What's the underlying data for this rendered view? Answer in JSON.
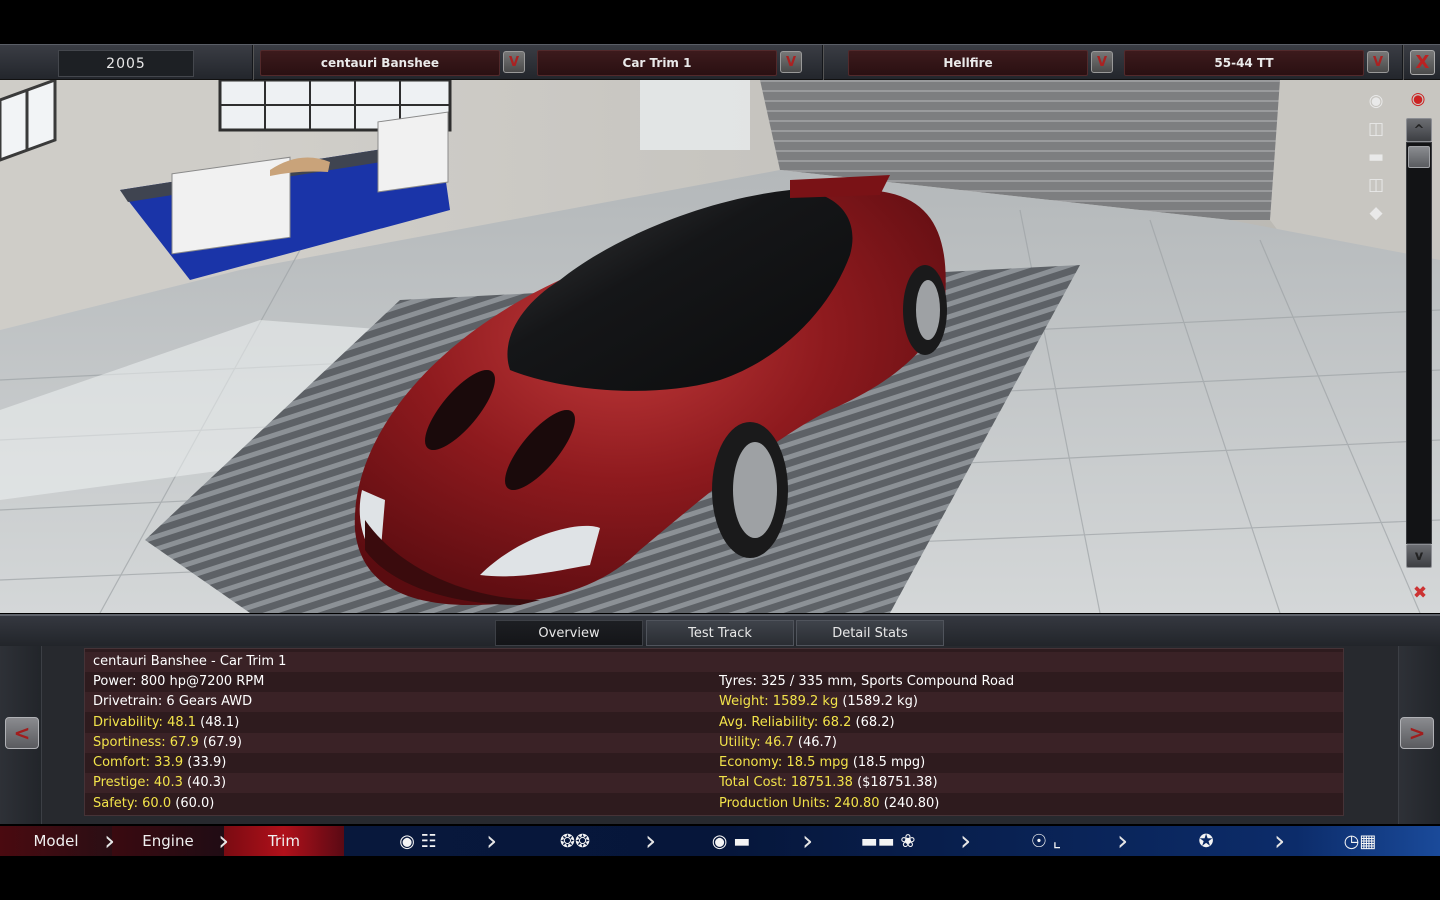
{
  "header": {
    "year": "2005",
    "model_select": "centauri Banshee",
    "trim_select": "Car Trim 1",
    "engine_select": "Hellfire",
    "variant_select": "55-44 TT",
    "dropdown_glyph": "V",
    "close_glyph": "X"
  },
  "viewport": {
    "tools": [
      "camera-icon",
      "eye-icon",
      "car-front-icon",
      "car-side-icon",
      "car-rear-icon",
      "car-top-icon"
    ],
    "scroll_up": "^",
    "scroll_down": "v"
  },
  "tabs": [
    "Overview",
    "Test Track",
    "Detail Stats"
  ],
  "active_tab": "Overview",
  "nav_prev": "<",
  "nav_next": ">",
  "stats": {
    "title": "centauri Banshee - Car Trim 1",
    "power": "Power: 800 hp@7200 RPM",
    "drivetrain": "Drivetrain: 6 Gears AWD",
    "tyres": "Tyres: 325 / 335 mm, Sports Compound Road",
    "left": [
      {
        "label": "Drivability: 48.1",
        "paren": "(48.1)"
      },
      {
        "label": "Sportiness: 67.9",
        "paren": "(67.9)"
      },
      {
        "label": "Comfort: 33.9",
        "paren": "(33.9)"
      },
      {
        "label": "Prestige: 40.3",
        "paren": "(40.3)"
      },
      {
        "label": "Safety: 60.0",
        "paren": "(60.0)"
      }
    ],
    "right": [
      {
        "label": "Weight: 1589.2 kg",
        "paren": "(1589.2 kg)"
      },
      {
        "label": "Avg. Reliability: 68.2",
        "paren": "(68.2)"
      },
      {
        "label": "Utility: 46.7",
        "paren": "(46.7)"
      },
      {
        "label": "Economy: 18.5 mpg",
        "paren": "(18.5 mpg)"
      },
      {
        "label": "Total Cost: 18751.38",
        "paren": "($18751.38)"
      },
      {
        "label": "Production Units: 240.80",
        "paren": "(240.80)"
      }
    ]
  },
  "bottom_nav": {
    "model": "Model",
    "engine": "Engine",
    "trim": "Trim",
    "icons": [
      "gearbox-icon",
      "wheels-icon",
      "body-icon",
      "aero-icon",
      "interior-icon",
      "suspension-icon",
      "test-icon"
    ]
  },
  "colors": {
    "highlight_text": "#f2e34a",
    "car_body": "#8e1a1e",
    "trim_active": "#b0101a"
  }
}
